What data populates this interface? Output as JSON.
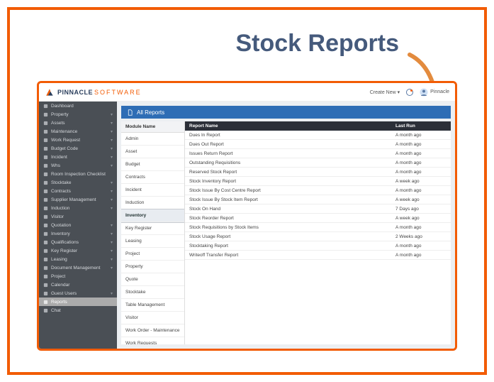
{
  "callout": {
    "title": "Stock Reports"
  },
  "header": {
    "brand1": "PINNACLE",
    "brand2": "SOFTWARE",
    "create": "Create New ",
    "user": "Pinnacle"
  },
  "sidebar": {
    "items": [
      {
        "label": "Dashboard",
        "icon": "dashboard-icon",
        "expand": false
      },
      {
        "label": "Property",
        "icon": "building-icon",
        "expand": true
      },
      {
        "label": "Assets",
        "icon": "gear-icon",
        "expand": true
      },
      {
        "label": "Maintenance",
        "icon": "wrench-icon",
        "expand": true
      },
      {
        "label": "Work Request",
        "icon": "clipboard-icon",
        "expand": true
      },
      {
        "label": "Budget Code",
        "icon": "dollar-icon",
        "expand": true
      },
      {
        "label": "Incident",
        "icon": "warning-icon",
        "expand": true
      },
      {
        "label": "Whs",
        "icon": "shield-icon",
        "expand": true
      },
      {
        "label": "Room Inspection Checklist",
        "icon": "list-icon",
        "expand": false
      },
      {
        "label": "Stocktake",
        "icon": "box-icon",
        "expand": true
      },
      {
        "label": "Contracts",
        "icon": "file-icon",
        "expand": true
      },
      {
        "label": "Supplier Management",
        "icon": "truck-icon",
        "expand": true
      },
      {
        "label": "Induction",
        "icon": "user-icon",
        "expand": true
      },
      {
        "label": "Visitor",
        "icon": "eye-icon",
        "expand": false
      },
      {
        "label": "Quotation",
        "icon": "quote-icon",
        "expand": true
      },
      {
        "label": "Inventory",
        "icon": "inventory-icon",
        "expand": true
      },
      {
        "label": "Qualifications",
        "icon": "badge-icon",
        "expand": true
      },
      {
        "label": "Key Register",
        "icon": "key-icon",
        "expand": true
      },
      {
        "label": "Leasing",
        "icon": "lease-icon",
        "expand": true
      },
      {
        "label": "Document Management",
        "icon": "doc-icon",
        "expand": true
      },
      {
        "label": "Project",
        "icon": "project-icon",
        "expand": false
      },
      {
        "label": "Calendar",
        "icon": "calendar-icon",
        "expand": false
      },
      {
        "label": "Guest Users",
        "icon": "guest-icon",
        "expand": true
      },
      {
        "label": "Reports",
        "icon": "report-icon",
        "expand": false,
        "active": true
      },
      {
        "label": "Chat",
        "icon": "chat-icon",
        "expand": false
      }
    ]
  },
  "content": {
    "title": "All Reports",
    "module_head": "Module Name",
    "modules": [
      "Admin",
      "Asset",
      "Budget",
      "Contracts",
      "Incident",
      "Induction",
      "Inventory",
      "Key Register",
      "Leasing",
      "Project",
      "Property",
      "Quote",
      "Stocktake",
      "Table Management",
      "Visitor",
      "Work Order - Maintenance",
      "Work Requests"
    ],
    "selected_module_index": 6,
    "table": {
      "head_name": "Report Name",
      "head_run": "Last Run",
      "rows": [
        {
          "name": "Dues In Report",
          "run": "A month ago"
        },
        {
          "name": "Dues Out Report",
          "run": "A month ago"
        },
        {
          "name": "Issues Return Report",
          "run": "A month ago"
        },
        {
          "name": "Outstanding Requisitions",
          "run": "A month ago"
        },
        {
          "name": "Reserved Stock Report",
          "run": "A month ago"
        },
        {
          "name": "Stock Inventory Report",
          "run": "A week ago"
        },
        {
          "name": "Stock Issue By Cost Centre Report",
          "run": "A month ago"
        },
        {
          "name": "Stock Issue By Stock Item Report",
          "run": "A week ago"
        },
        {
          "name": "Stock On Hand",
          "run": "7 Days ago"
        },
        {
          "name": "Stock Reorder Report",
          "run": "A week ago"
        },
        {
          "name": "Stock Requisitions by Stock Items",
          "run": "A month ago"
        },
        {
          "name": "Stock Usage Report",
          "run": "2 Weeks ago"
        },
        {
          "name": "Stocktaking Report",
          "run": "A month ago"
        },
        {
          "name": "Writeoff Transfer Report",
          "run": "A month ago"
        }
      ]
    }
  }
}
